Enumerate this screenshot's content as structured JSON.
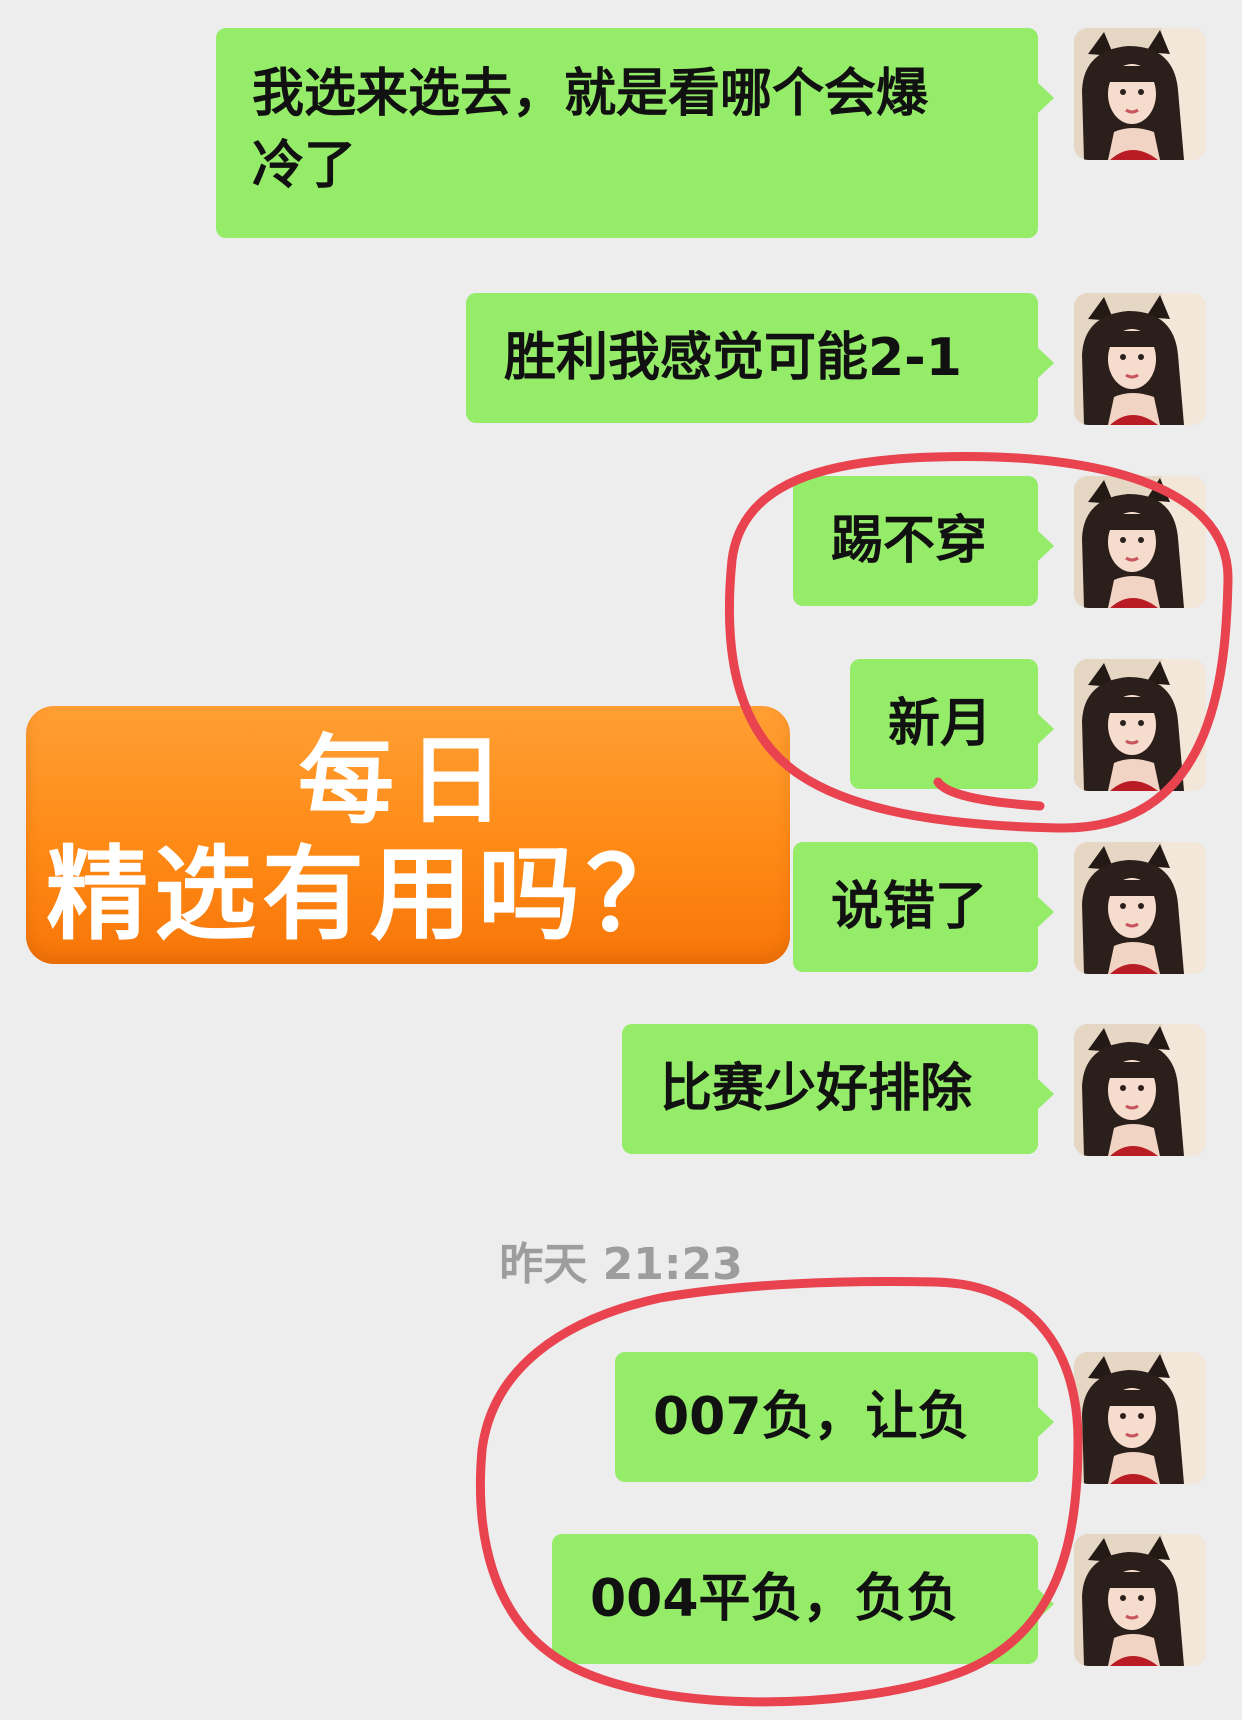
{
  "messages": [
    {
      "line1": "我选来选去，就是看哪个会爆",
      "line2": "冷了"
    },
    {
      "text": "胜利我感觉可能2-1"
    },
    {
      "text": "踢不穿"
    },
    {
      "text": "新月"
    },
    {
      "text": "说错了"
    },
    {
      "text": "比赛少好排除"
    },
    {
      "text": "007负，让负"
    },
    {
      "text": "004平负，负负"
    }
  ],
  "timestamp": "昨天 21:23",
  "banner": {
    "line1": "每日",
    "line2": "精选有用吗？"
  },
  "colors": {
    "background": "#ededed",
    "bubble": "#95ec69",
    "banner": "#ff8a16",
    "circle": "#e8434f"
  },
  "icons": {
    "avatar": "user-avatar-icon"
  }
}
